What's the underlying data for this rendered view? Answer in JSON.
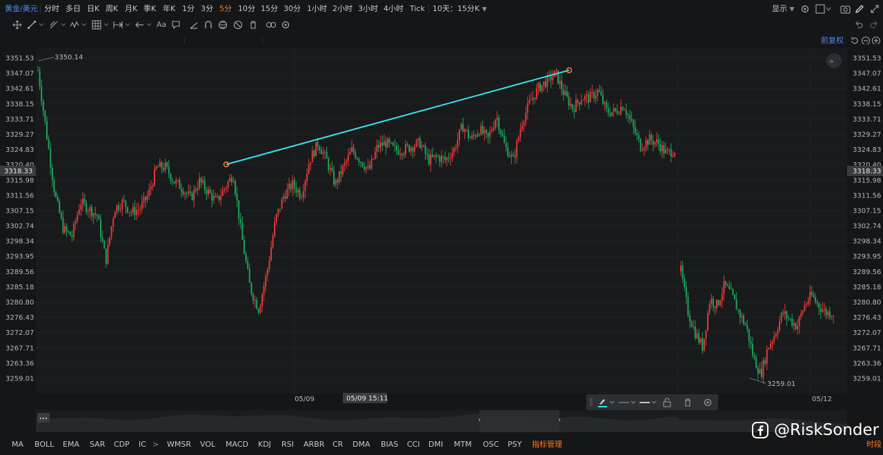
{
  "symbol": "黄金/美元",
  "timeframes": [
    {
      "label": "分时",
      "active": false
    },
    {
      "label": "多日",
      "active": false
    },
    {
      "label": "日K",
      "active": false
    },
    {
      "label": "周K",
      "active": false
    },
    {
      "label": "月K",
      "active": false
    },
    {
      "label": "季K",
      "active": false
    },
    {
      "label": "年K",
      "active": false
    },
    {
      "label": "1分",
      "active": false
    },
    {
      "label": "3分",
      "active": false
    },
    {
      "label": "5分",
      "active": true
    },
    {
      "label": "10分",
      "active": false
    },
    {
      "label": "15分",
      "active": false
    },
    {
      "label": "30分",
      "active": false
    },
    {
      "label": "1小时",
      "active": false
    },
    {
      "label": "2小时",
      "active": false
    },
    {
      "label": "3小时",
      "active": false
    },
    {
      "label": "4小时",
      "active": false
    },
    {
      "label": "Tick",
      "active": false
    }
  ],
  "range_select": "10天：15分K",
  "display_menu": "显示",
  "toolbar": {
    "text_tool": "Aa"
  },
  "adjust_label": "前复权",
  "chart_data": {
    "type": "candlestick",
    "price_axis_ticks": [
      "3351.53",
      "3347.07",
      "3342.61",
      "3338.15",
      "3333.71",
      "3329.27",
      "3324.83",
      "3320.40",
      "3315.98",
      "3311.56",
      "3307.15",
      "3302.74",
      "3298.34",
      "3293.95",
      "3289.56",
      "3285.18",
      "3280.80",
      "3276.43",
      "3272.07",
      "3267.71",
      "3263.36",
      "3259.01"
    ],
    "ylim": [
      3259.01,
      3351.53
    ],
    "time_labels": [
      "05/09",
      "05/12"
    ],
    "crosshair_time": "05/09 15:11",
    "current_price": "3318.33",
    "high_label": "3350.14",
    "low_label": "3259.01",
    "colors": {
      "up": "#e03b3b",
      "down": "#1fa35c",
      "trendline": "#3ce0f0"
    },
    "trendline": {
      "start": {
        "time": "05/09 15:11",
        "price": 3320.8
      },
      "end": {
        "price": 3348.0
      }
    },
    "segments": [
      {
        "session": "before-gap",
        "close_path": [
          3348,
          3330,
          3312,
          3302,
          3300,
          3310,
          3308,
          3306,
          3293,
          3308,
          3310,
          3307,
          3308,
          3312,
          3320,
          3320,
          3316,
          3314,
          3311,
          3316,
          3313,
          3310,
          3314,
          3318,
          3300,
          3285,
          3279,
          3290,
          3305,
          3312,
          3315,
          3312,
          3322,
          3327,
          3322,
          3315,
          3320,
          3325,
          3322,
          3319,
          3326,
          3327,
          3325,
          3325,
          3326,
          3327,
          3322,
          3323,
          3322,
          3325,
          3332,
          3328,
          3331,
          3328,
          3335,
          3326,
          3322,
          3333,
          3339,
          3343,
          3345,
          3347,
          3341,
          3337,
          3340,
          3340,
          3342,
          3336,
          3336,
          3338,
          3332,
          3326,
          3328,
          3327,
          3324,
          3325
        ]
      },
      {
        "session": "after-gap",
        "close_path": [
          3290,
          3278,
          3272,
          3268,
          3282,
          3280,
          3286,
          3283,
          3278,
          3274,
          3265,
          3260,
          3268,
          3272,
          3278,
          3276,
          3274,
          3280,
          3283,
          3280,
          3278,
          3278
        ]
      }
    ]
  },
  "float_toolbar": {
    "label": "drawing-style-toolbar"
  },
  "indicators": [
    {
      "label": "MA",
      "active": false
    },
    {
      "label": "BOLL",
      "active": false
    },
    {
      "label": "EMA",
      "active": false
    },
    {
      "label": "SAR",
      "active": false
    },
    {
      "label": "CDP",
      "active": false
    },
    {
      "label": "IC",
      "active": false
    },
    {
      "label": ">",
      "active": false
    },
    {
      "label": "WMSR",
      "active": false
    },
    {
      "label": "VOL",
      "active": false
    },
    {
      "label": "MACD",
      "active": false
    },
    {
      "label": "KDJ",
      "active": false
    },
    {
      "label": "RSI",
      "active": false
    },
    {
      "label": "ARBR",
      "active": false
    },
    {
      "label": "CR",
      "active": false
    },
    {
      "label": "DMA",
      "active": false
    },
    {
      "label": "BIAS",
      "active": false
    },
    {
      "label": "CCI",
      "active": false
    },
    {
      "label": "DMI",
      "active": false
    },
    {
      "label": "MTM",
      "active": false
    },
    {
      "label": "OSC",
      "active": false
    },
    {
      "label": "PSY",
      "active": false
    },
    {
      "label": "指标管理",
      "active": true
    }
  ],
  "period_tab": "时段",
  "watermark": "@RiskSonder"
}
